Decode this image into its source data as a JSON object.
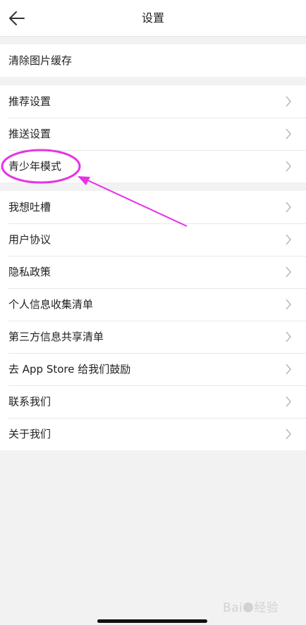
{
  "header": {
    "title": "设置",
    "back_icon": "back-arrow-icon"
  },
  "groups": [
    {
      "items": [
        {
          "label": "清除图片缓存",
          "chevron": false
        }
      ]
    },
    {
      "items": [
        {
          "label": "推荐设置",
          "chevron": true
        },
        {
          "label": "推送设置",
          "chevron": true
        },
        {
          "label": "青少年模式",
          "chevron": true,
          "highlighted": true
        }
      ]
    },
    {
      "items": [
        {
          "label": "我想吐槽",
          "chevron": true
        },
        {
          "label": "用户协议",
          "chevron": true
        },
        {
          "label": "隐私政策",
          "chevron": true
        },
        {
          "label": "个人信息收集清单",
          "chevron": true
        },
        {
          "label": "第三方信息共享清单",
          "chevron": true
        },
        {
          "label": "去 App Store 给我们鼓励",
          "chevron": true
        },
        {
          "label": "联系我们",
          "chevron": true
        },
        {
          "label": "关于我们",
          "chevron": true
        }
      ]
    }
  ],
  "annotation": {
    "color": "#e633e6",
    "shape": "ellipse-with-arrow",
    "target": "青少年模式"
  },
  "watermark": {
    "text_left": "Bai",
    "text_right": "经验"
  },
  "colors": {
    "background": "#f2f2f2",
    "surface": "#ffffff",
    "chevron": "#b8b8b8",
    "text": "#222222"
  }
}
